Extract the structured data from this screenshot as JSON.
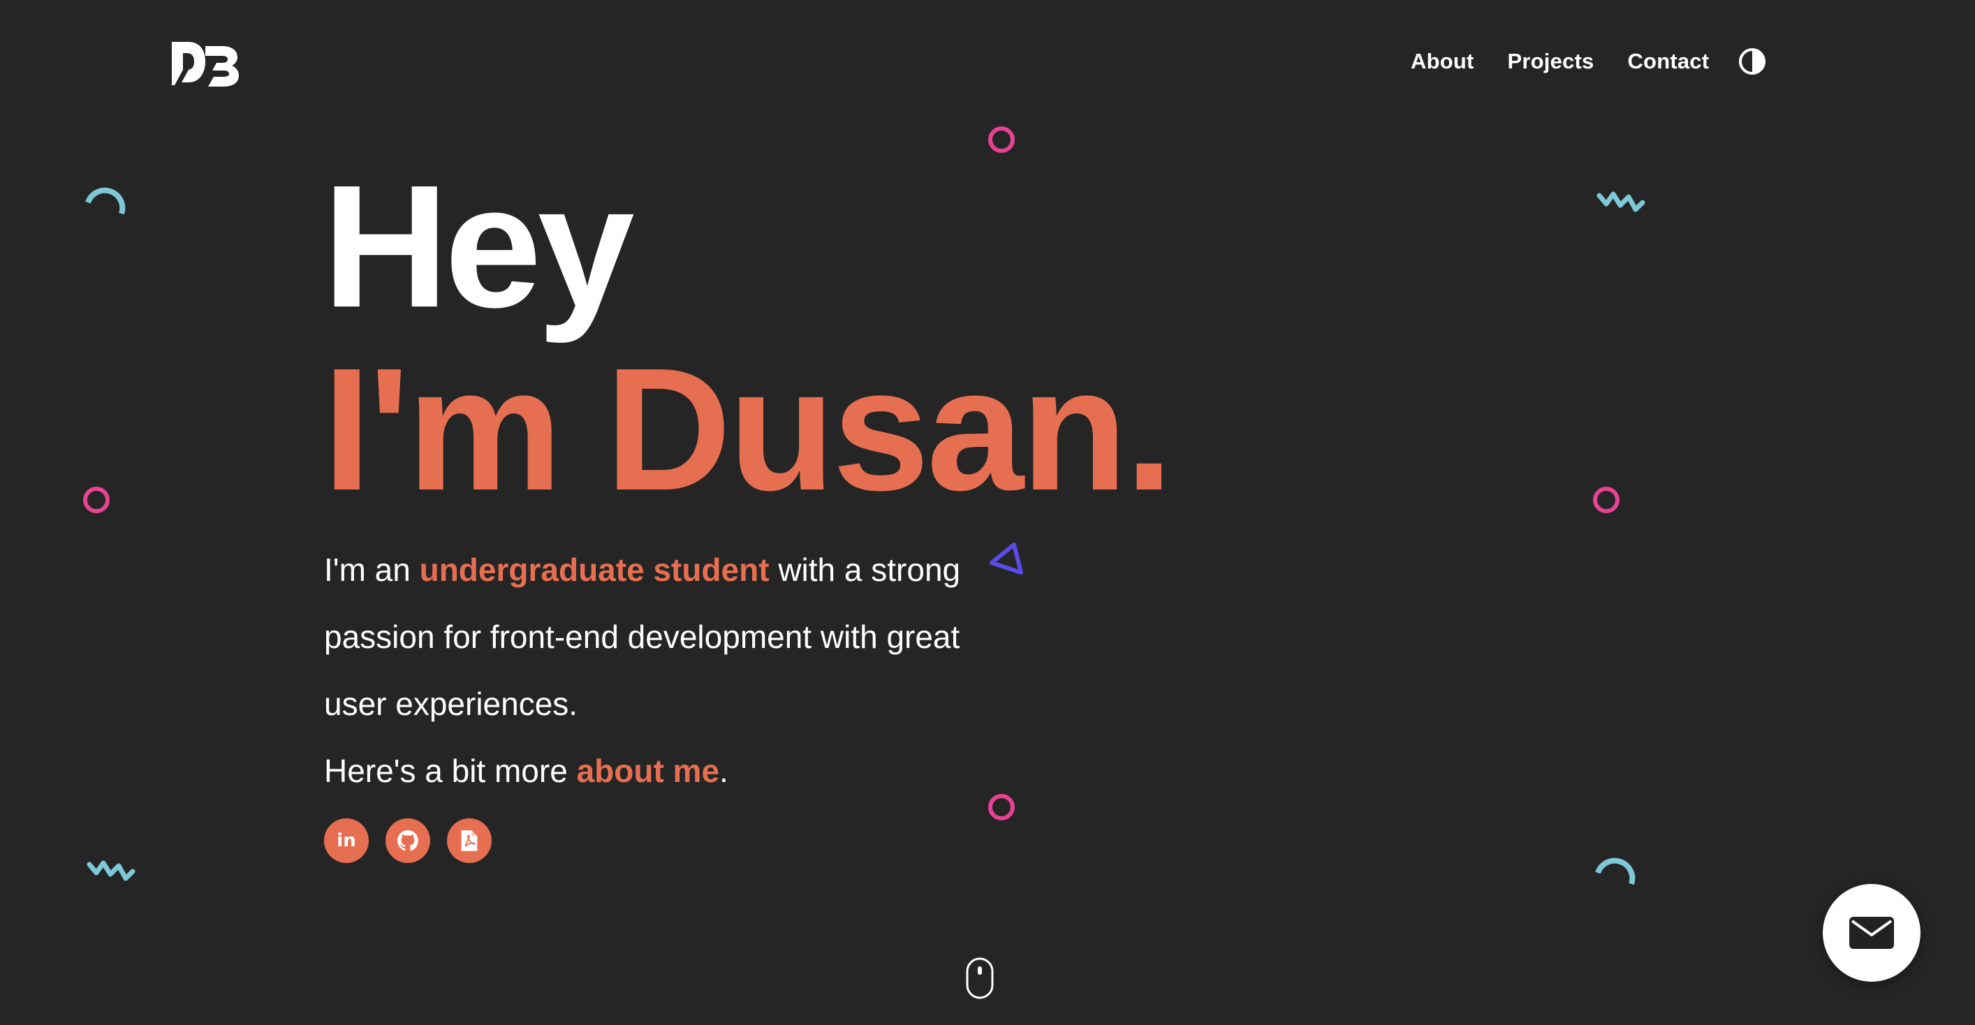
{
  "logo": {
    "text": "DB",
    "icon": "db-logo"
  },
  "nav": {
    "items": [
      "About",
      "Projects",
      "Contact"
    ],
    "theme_toggle_icon": "half-circle-contrast-icon"
  },
  "hero": {
    "greeting": "Hey",
    "name": "I'm Dusan.",
    "intro": {
      "before": "I'm an ",
      "highlight": "undergraduate student",
      "after": " with a strong passion for front-end development with great user experiences.",
      "more_before": "Here's a bit more ",
      "more_link": "about me",
      "more_after": "."
    },
    "socials": [
      {
        "icon": "linkedin-icon",
        "text": "in"
      },
      {
        "icon": "github-icon"
      },
      {
        "icon": "pdf-file-icon"
      }
    ]
  },
  "floating_buttons": {
    "mail_icon": "envelope-icon"
  },
  "scroll_indicator": {
    "icon": "mouse-scroll-icon"
  },
  "colors": {
    "background": "#252526",
    "accent": "#e76f51",
    "pink": "#e84393",
    "cyan": "#7ec8d8",
    "purple": "#5b4ce8",
    "text": "#ffffff"
  }
}
